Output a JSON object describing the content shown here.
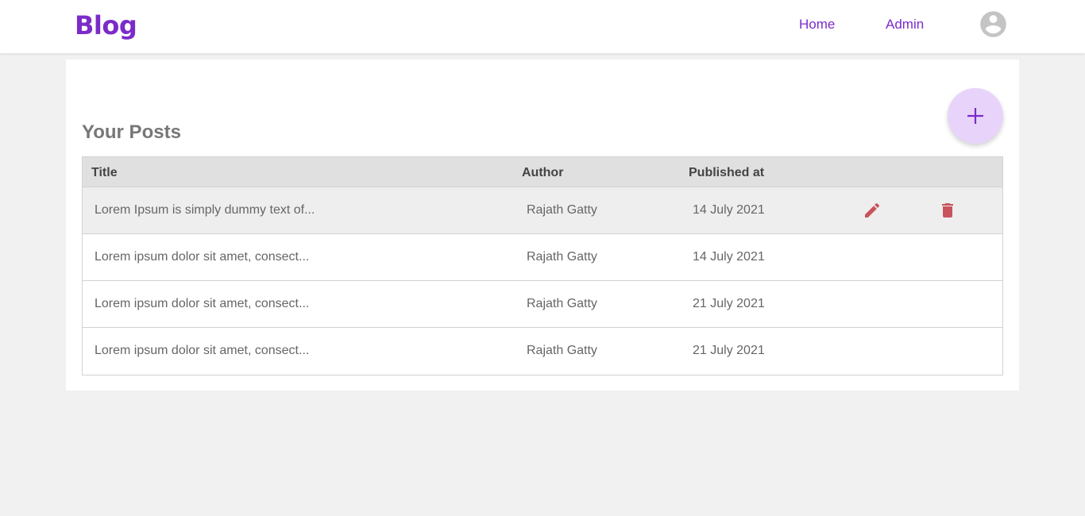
{
  "navbar": {
    "brand": "Blog",
    "links": [
      {
        "label": "Home"
      },
      {
        "label": "Admin"
      }
    ],
    "avatar_icon": "account-circle-icon"
  },
  "colors": {
    "brand": "#7b2bc9",
    "fab_bg": "#e8d4fa",
    "action_icon": "#c9535c",
    "page_bg": "#f1f1f1"
  },
  "main": {
    "title": "Your Posts",
    "add_button_icon": "plus-icon",
    "table": {
      "columns": [
        "Title",
        "Author",
        "Published at"
      ],
      "rows": [
        {
          "title": "Lorem Ipsum is simply dummy text of...",
          "author": "Rajath Gatty",
          "published": "14 July 2021"
        },
        {
          "title": "Lorem ipsum dolor sit amet, consect...",
          "author": "Rajath Gatty",
          "published": "14 July 2021"
        },
        {
          "title": "Lorem ipsum dolor sit amet, consect...",
          "author": "Rajath Gatty",
          "published": "21 July 2021"
        },
        {
          "title": "Lorem ipsum dolor sit amet, consect...",
          "author": "Rajath Gatty",
          "published": "21 July 2021"
        }
      ],
      "row_actions": [
        "pencil-icon",
        "trash-icon"
      ]
    }
  }
}
